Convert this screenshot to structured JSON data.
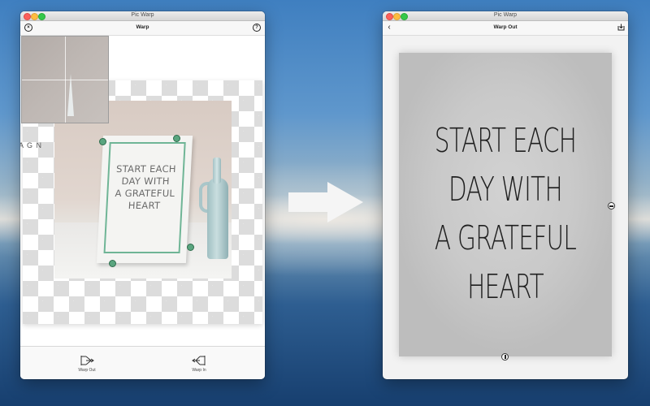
{
  "left_window": {
    "title": "Pic Warp",
    "nav_title": "Warp",
    "sign_text": [
      "START EACH",
      "DAY WITH",
      "A GRATEFUL",
      "HEART"
    ],
    "magnifier_letters": "A G N",
    "tools": [
      {
        "label": "Warp Out",
        "icon": "warp-out-icon"
      },
      {
        "label": "Warp In",
        "icon": "warp-in-icon"
      }
    ],
    "icons": {
      "left": "close-circle-icon",
      "right": "help-icon"
    }
  },
  "right_window": {
    "title": "Pic Warp",
    "nav_title": "Warp Out",
    "paper_text": [
      "START EACH",
      "DAY WITH",
      "A GRATEFUL",
      "HEART"
    ],
    "icons": {
      "left": "back-chevron-icon",
      "right": "save-download-icon"
    }
  },
  "colors": {
    "handle_green": "#5aa57f",
    "quad_line": "#6fb596",
    "arrow": "#f5f5f5"
  }
}
